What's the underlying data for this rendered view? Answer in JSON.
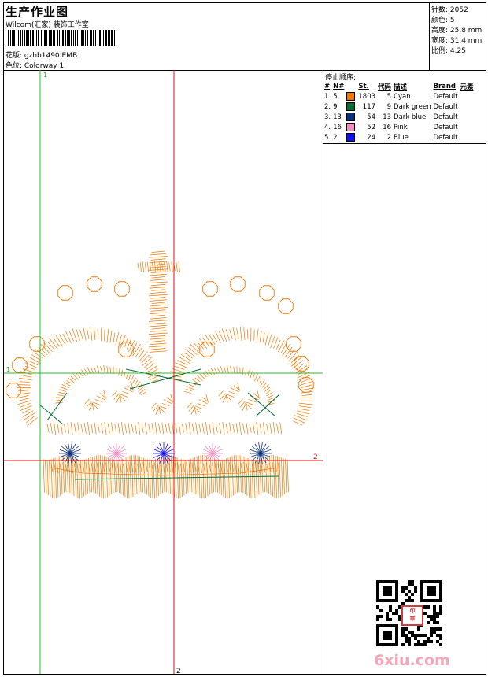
{
  "header": {
    "title": "生产作业图",
    "studio": "Wilcom(汇家) 装饰工作室",
    "design_line": "花版: gzhb1490.EMB",
    "colorway_line": "色位: Colorway 1"
  },
  "stats": {
    "stitches": "针数: 2052",
    "colors": "颜色: 5",
    "height": "高度: 25.8 mm",
    "width": "宽度: 31.4 mm",
    "ratio": "比例: 4.25"
  },
  "stop_sequence": {
    "title": "停止顺序:",
    "headers": [
      "#",
      "N#",
      "St.",
      "代码",
      "描述",
      "Brand",
      "元素"
    ],
    "rows": [
      {
        "order": "1.",
        "needle": "5",
        "color": "#f07800",
        "st": "1803",
        "code": "5",
        "desc": "Cyan",
        "brand": "Default"
      },
      {
        "order": "2.",
        "needle": "9",
        "color": "#006b33",
        "st": "117",
        "code": "9",
        "desc": "Dark green",
        "brand": "Default"
      },
      {
        "order": "3.",
        "needle": "13",
        "color": "#0b2f7a",
        "st": "54",
        "code": "13",
        "desc": "Dark blue",
        "brand": "Default"
      },
      {
        "order": "4.",
        "needle": "16",
        "color": "#f28fc4",
        "st": "52",
        "code": "16",
        "desc": "Pink",
        "brand": "Default"
      },
      {
        "order": "5.",
        "needle": "2",
        "color": "#1010ee",
        "st": "24",
        "code": "2",
        "desc": "Blue",
        "brand": "Default"
      }
    ]
  },
  "canvas": {
    "guide_green": "#22c422",
    "guide_red": "#e01010",
    "label_green_1": "1",
    "label_green_2": "1",
    "label_red_1": "2",
    "label_red_2": "2"
  },
  "watermark": {
    "text": "6xiu.com"
  }
}
